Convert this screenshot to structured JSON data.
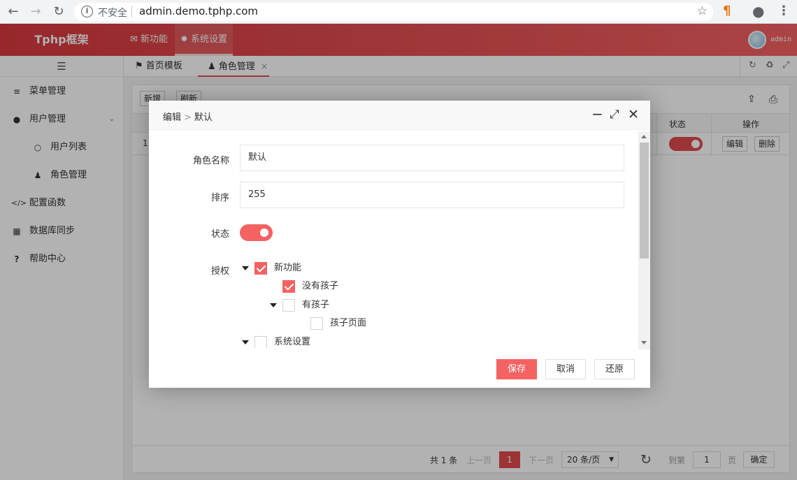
{
  "browser": {
    "insecure_label": "不安全",
    "url": "admin.demo.tphp.com"
  },
  "header": {
    "logo": "Tphp框架",
    "nav": [
      "新功能",
      "系统设置"
    ],
    "active_nav": "系统设置",
    "username": "admin",
    "accent": "#e04a4c"
  },
  "sidebar": {
    "items": [
      {
        "label": "菜单管理",
        "icon": "list-icon"
      },
      {
        "label": "用户管理",
        "icon": "user-icon"
      },
      {
        "label": "用户列表",
        "icon": "user-outline-icon"
      },
      {
        "label": "角色管理",
        "icon": "person-icon"
      },
      {
        "label": "配置函数",
        "icon": "code-icon"
      },
      {
        "label": "数据库同步",
        "icon": "table-icon"
      },
      {
        "label": "帮助中心",
        "icon": "question-icon"
      }
    ]
  },
  "tabs": [
    {
      "label": "首页模板"
    },
    {
      "label": "角色管理",
      "close": "×"
    }
  ],
  "content": {
    "toolbar": {
      "add": "新增",
      "refresh": "刷新"
    },
    "columns": {
      "status": "状态",
      "action": "操作"
    },
    "row": {
      "index": "1",
      "edit": "编辑",
      "delete": "删除"
    },
    "pager": {
      "total": "共 1 条",
      "prev": "上一页",
      "current": "1",
      "next": "下一页",
      "page_size": "20 条/页",
      "goto": "到第",
      "goto_value": "1",
      "page_unit": "页",
      "confirm": "确定"
    }
  },
  "modal": {
    "breadcrumb": {
      "parent": "编辑",
      "sep": ">",
      "current": "默认"
    },
    "fields": {
      "name_label": "角色名称",
      "name_value": "默认",
      "sort_label": "排序",
      "sort_value": "255",
      "status_label": "状态",
      "auth_label": "授权"
    },
    "tree": [
      {
        "label": "新功能",
        "checked": true
      },
      {
        "label": "没有孩子",
        "checked": true
      },
      {
        "label": "有孩子",
        "checked": false
      },
      {
        "label": "孩子页面",
        "checked": false
      },
      {
        "label": "系统设置",
        "checked": false
      }
    ],
    "buttons": {
      "save": "保存",
      "cancel": "取消",
      "reset": "还原"
    }
  }
}
